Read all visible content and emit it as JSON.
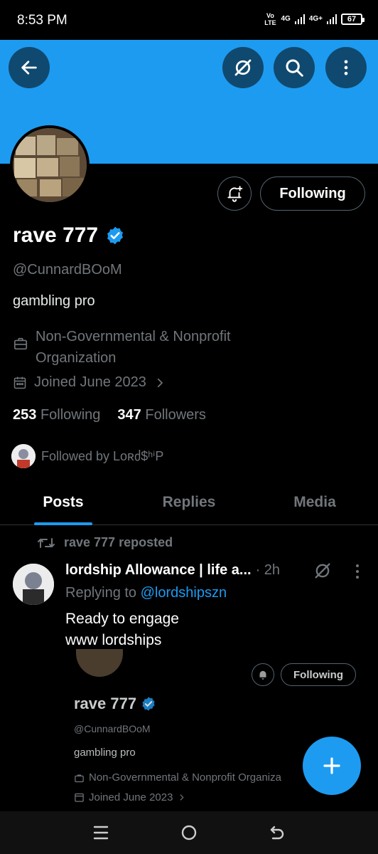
{
  "status_bar": {
    "time": "8:53 PM",
    "volte": "Vo LTE",
    "net1": "4G",
    "net2": "4G+",
    "battery": "67"
  },
  "profile": {
    "display_name": "rave 777",
    "handle": "@CunnardBOoM",
    "bio": "gambling pro",
    "category": "Non-Governmental & Nonprofit Organization",
    "joined": "Joined June 2023",
    "following_count": "253",
    "following_label": "Following",
    "followers_count": "347",
    "followers_label": "Followers",
    "followed_by": "Followed by Lᴏʀძ$ʰⁱP",
    "follow_button": "Following"
  },
  "tabs": [
    {
      "label": "Posts",
      "active": true
    },
    {
      "label": "Replies",
      "active": false
    },
    {
      "label": "Media",
      "active": false
    }
  ],
  "post": {
    "repost_label": "rave 777 reposted",
    "author": "lordship Allowance | life a...",
    "time": "· 2h",
    "replying_prefix": "Replying to",
    "replying_to": "@lordshipszn",
    "text_line1": "Ready to engage",
    "text_line2": "www lordships",
    "embed": {
      "display_name": "rave 777",
      "handle": "@CunnardBOoM",
      "bio": "gambling pro",
      "category": "Non-Governmental & Nonprofit Organiza",
      "joined": "Joined June 2023",
      "follow_button": "Following"
    }
  },
  "colors": {
    "accent": "#1d9bf0",
    "background": "#000000",
    "muted": "#71767b"
  },
  "icons": {
    "back": "arrow-left-icon",
    "grok": "grok-icon",
    "search": "search-icon",
    "more": "more-vertical-icon",
    "bell": "bell-plus-icon",
    "verified": "verified-badge-icon",
    "briefcase": "briefcase-icon",
    "calendar": "calendar-icon",
    "repost": "repost-icon",
    "compose": "plus-icon"
  }
}
